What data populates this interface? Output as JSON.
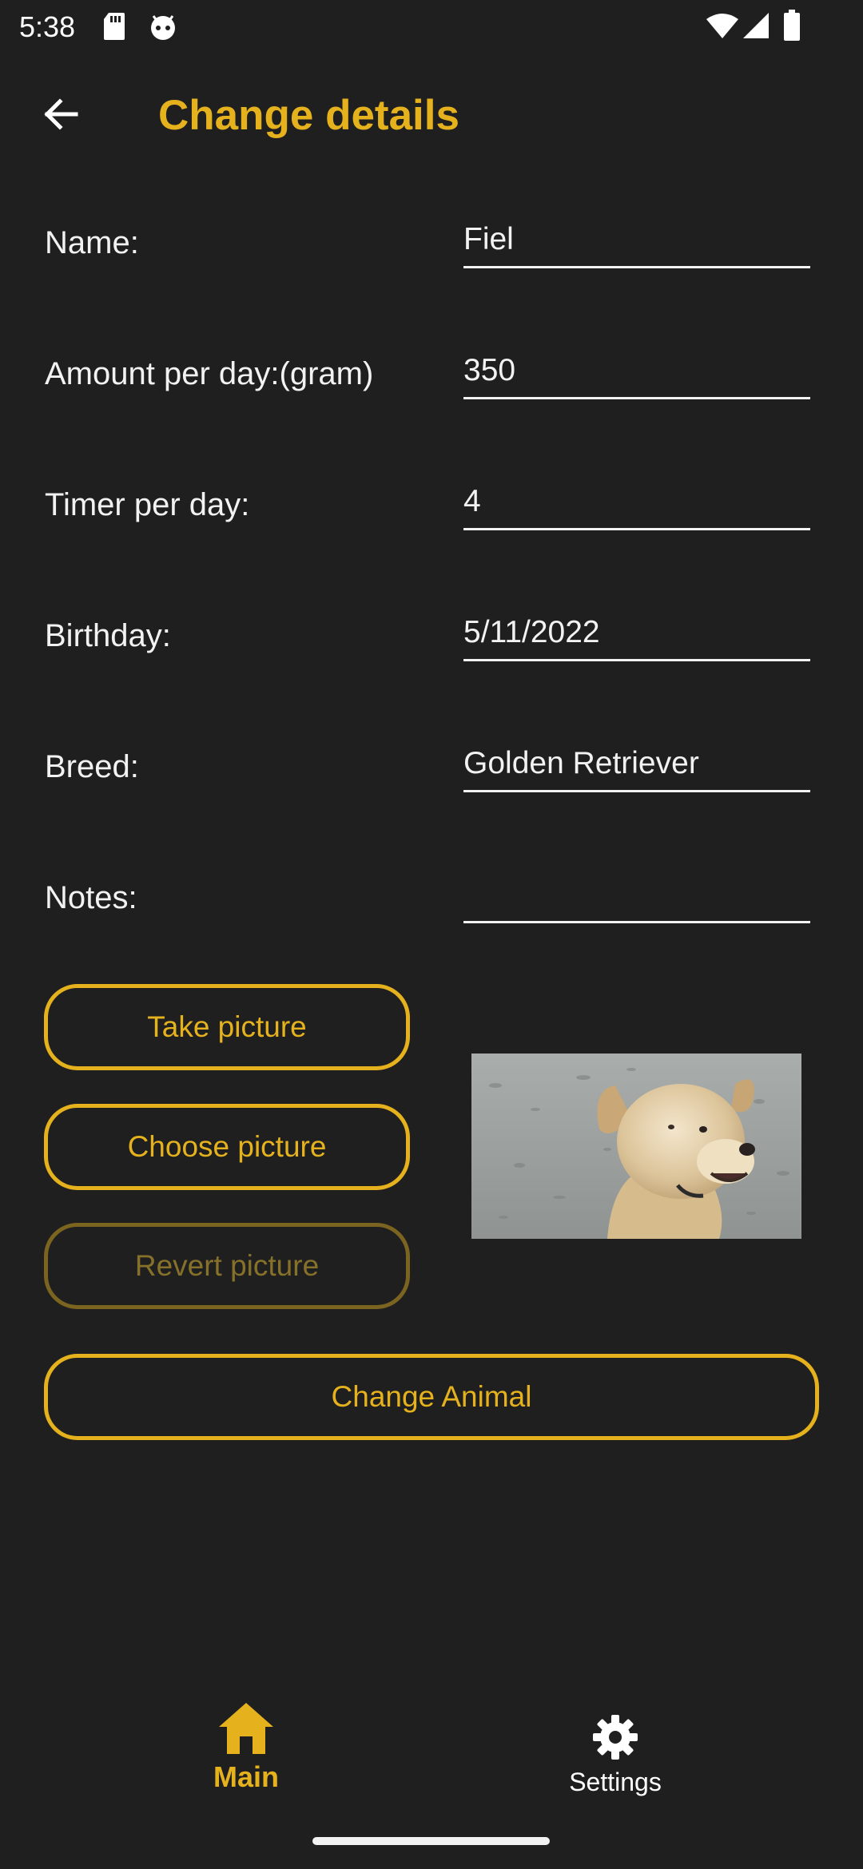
{
  "status_bar": {
    "time": "5:38",
    "icons": [
      "sd-card-icon",
      "android-face-icon",
      "wifi-icon",
      "cellular-signal-icon",
      "battery-icon"
    ]
  },
  "app_bar": {
    "back_icon": "arrow-back-icon",
    "title": "Change details"
  },
  "form": {
    "name": {
      "label": "Name:",
      "value": "Fiel"
    },
    "amount": {
      "label": "Amount per day:(gram)",
      "value": "350"
    },
    "timer": {
      "label": "Timer per day:",
      "value": "4"
    },
    "birthday": {
      "label": "Birthday:",
      "value": "5/11/2022"
    },
    "breed": {
      "label": "Breed:",
      "value": "Golden Retriever"
    },
    "notes": {
      "label": "Notes:",
      "value": ""
    }
  },
  "picture": {
    "take_label": "Take picture",
    "choose_label": "Choose picture",
    "revert_label": "Revert picture",
    "revert_enabled": false
  },
  "submit_label": "Change Animal",
  "bottom_nav": {
    "main": {
      "label": "Main",
      "icon": "home-icon",
      "active": true
    },
    "settings": {
      "label": "Settings",
      "icon": "gear-icon",
      "active": false
    }
  },
  "colors": {
    "accent": "#e5b21e",
    "background": "#1f1f1f",
    "text": "#f2f2f2"
  }
}
